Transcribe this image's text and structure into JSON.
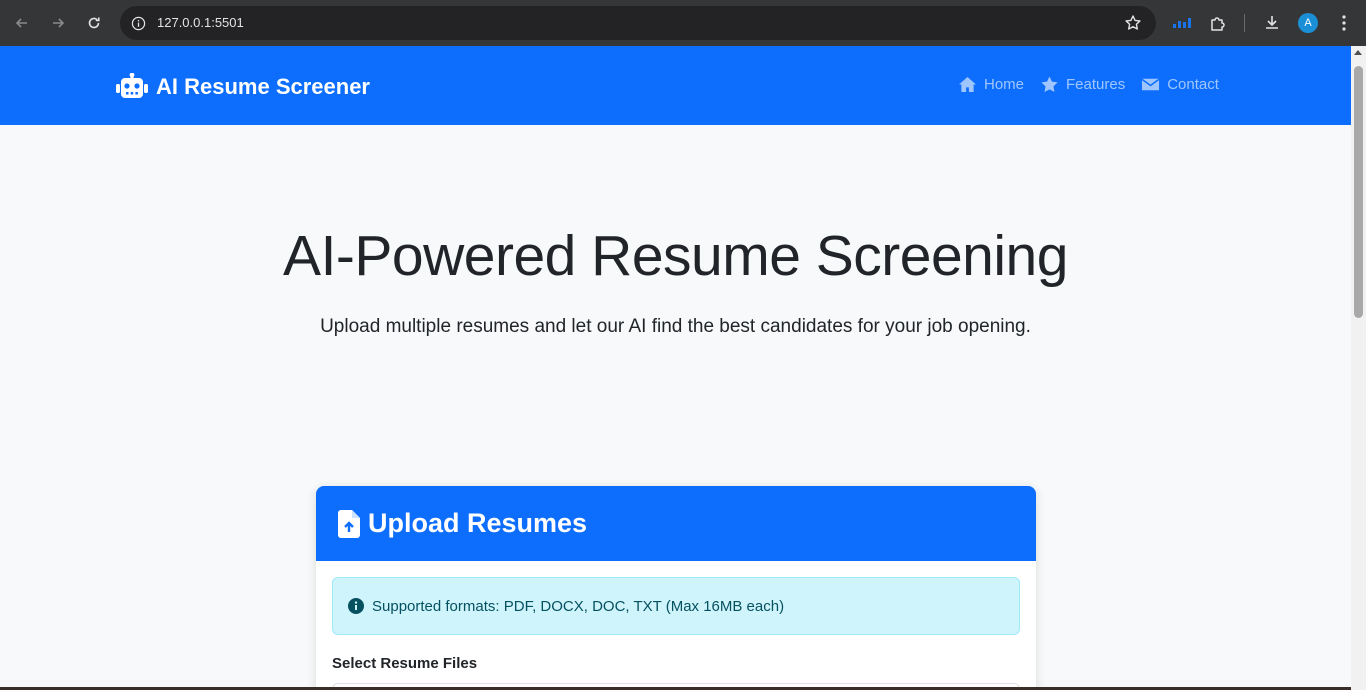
{
  "browser": {
    "url": "127.0.0.1:5501",
    "profile_initial": "A",
    "accent_color": "#1a8fd6"
  },
  "navbar": {
    "brand": "AI Resume Screener",
    "brand_icon": "robot-icon",
    "color": "#0d6efd",
    "links": [
      {
        "label": "Home",
        "icon": "home-icon"
      },
      {
        "label": "Features",
        "icon": "star-icon"
      },
      {
        "label": "Contact",
        "icon": "envelope-icon"
      }
    ]
  },
  "hero": {
    "title": "AI-Powered Resume Screening",
    "subtitle": "Upload multiple resumes and let our AI find the best candidates for your job opening."
  },
  "upload_card": {
    "title": "Upload Resumes",
    "icon": "file-upload-icon",
    "alert_text": "Supported formats: PDF, DOCX, DOC, TXT (Max 16MB each)",
    "alert_icon": "info-circle-icon",
    "field_label": "Select Resume Files"
  }
}
